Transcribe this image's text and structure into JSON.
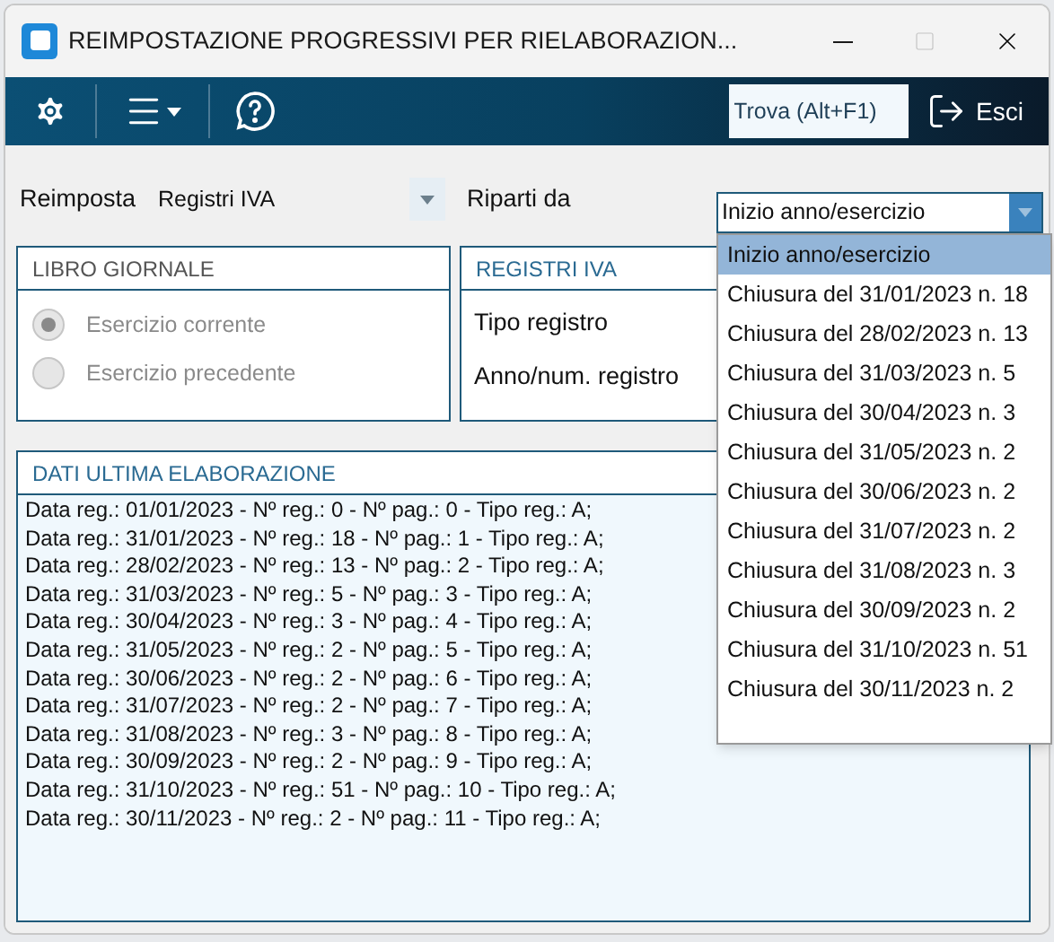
{
  "window": {
    "title": "REIMPOSTAZIONE PROGRESSIVI PER RIELABORAZION..."
  },
  "toolbar": {
    "search": {
      "placeholder": "Trova (Alt+F1)"
    },
    "exit_label": "Esci"
  },
  "form": {
    "reset_label": "Reimposta",
    "reset_value": "Registri IVA",
    "restart_label": "Riparti da",
    "restart_value": "Inizio anno/esercizio"
  },
  "libro_giornale": {
    "title": "LIBRO GIORNALE",
    "options": [
      {
        "label": "Esercizio corrente",
        "selected": true,
        "disabled": true
      },
      {
        "label": "Esercizio precedente",
        "selected": false,
        "disabled": true
      }
    ]
  },
  "registri_iva": {
    "title": "REGISTRI IVA",
    "fields": [
      "Tipo registro",
      "Anno/num. registro"
    ]
  },
  "dati_ultima_elaborazione": {
    "title": "DATI ULTIMA ELABORAZIONE",
    "lines": [
      "Data reg.: 01/01/2023 - Nº reg.: 0 - Nº pag.: 0 - Tipo reg.: A;",
      "Data reg.: 31/01/2023 - Nº reg.: 18 - Nº pag.: 1 - Tipo reg.: A;",
      "Data reg.: 28/02/2023 - Nº reg.: 13 - Nº pag.: 2 - Tipo reg.: A;",
      "Data reg.: 31/03/2023 - Nº reg.: 5 - Nº pag.: 3 - Tipo reg.: A;",
      "Data reg.: 30/04/2023 - Nº reg.: 3 - Nº pag.: 4 - Tipo reg.: A;",
      "Data reg.: 31/05/2023 - Nº reg.: 2 - Nº pag.: 5 - Tipo reg.: A;",
      "Data reg.: 30/06/2023 - Nº reg.: 2 - Nº pag.: 6 - Tipo reg.: A;",
      "Data reg.: 31/07/2023 - Nº reg.: 2 - Nº pag.: 7 - Tipo reg.: A;",
      "Data reg.: 31/08/2023 - Nº reg.: 3 - Nº pag.: 8 - Tipo reg.: A;",
      "Data reg.: 30/09/2023 - Nº reg.: 2 - Nº pag.: 9 - Tipo reg.: A;",
      "Data reg.: 31/10/2023 - Nº reg.: 51 - Nº pag.: 10 - Tipo reg.: A;",
      "Data reg.: 30/11/2023 - Nº reg.: 2 - Nº pag.: 11 - Tipo reg.: A;"
    ]
  },
  "dropdown": {
    "items": [
      {
        "label": "Inizio anno/esercizio",
        "selected": true
      },
      {
        "label": "Chiusura del 31/01/2023 n. 18",
        "selected": false
      },
      {
        "label": "Chiusura del 28/02/2023 n. 13",
        "selected": false
      },
      {
        "label": "Chiusura del 31/03/2023 n. 5",
        "selected": false
      },
      {
        "label": "Chiusura del 30/04/2023 n. 3",
        "selected": false
      },
      {
        "label": "Chiusura del 31/05/2023 n. 2",
        "selected": false
      },
      {
        "label": "Chiusura del 30/06/2023 n. 2",
        "selected": false
      },
      {
        "label": "Chiusura del 31/07/2023 n. 2",
        "selected": false
      },
      {
        "label": "Chiusura del 31/08/2023 n. 3",
        "selected": false
      },
      {
        "label": "Chiusura del 30/09/2023 n. 2",
        "selected": false
      },
      {
        "label": "Chiusura del 31/10/2023 n. 51",
        "selected": false
      },
      {
        "label": "Chiusura del 30/11/2023 n. 2",
        "selected": false
      }
    ]
  }
}
